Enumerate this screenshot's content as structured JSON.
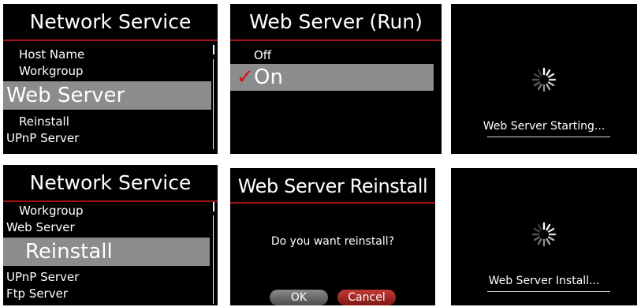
{
  "panel1": {
    "title": "Network Service",
    "items": [
      "Host Name",
      "Workgroup",
      "Web Server",
      "Reinstall",
      "UPnP Server"
    ]
  },
  "panel2": {
    "title": "Web Server (Run)",
    "options": [
      "Off",
      "On"
    ],
    "selected": "On",
    "check_mark": "✓"
  },
  "panel3": {
    "status": "Web Server Starting...",
    "spinner_icon": "loading-spinner"
  },
  "panel4": {
    "title": "Network Service",
    "items": [
      "Workgroup",
      "Web Server",
      "Reinstall",
      "UPnP Server",
      "Ftp Server"
    ]
  },
  "panel5": {
    "title": "Web Server Reinstall",
    "question": "Do you want reinstall?",
    "ok_label": "OK",
    "cancel_label": "Cancel"
  },
  "panel6": {
    "status": "Web Server Install...",
    "spinner_icon": "loading-spinner"
  },
  "colors": {
    "screen_bg": "#000000",
    "accent_red": "#a01216",
    "highlight_gray": "#8c8c8c"
  }
}
